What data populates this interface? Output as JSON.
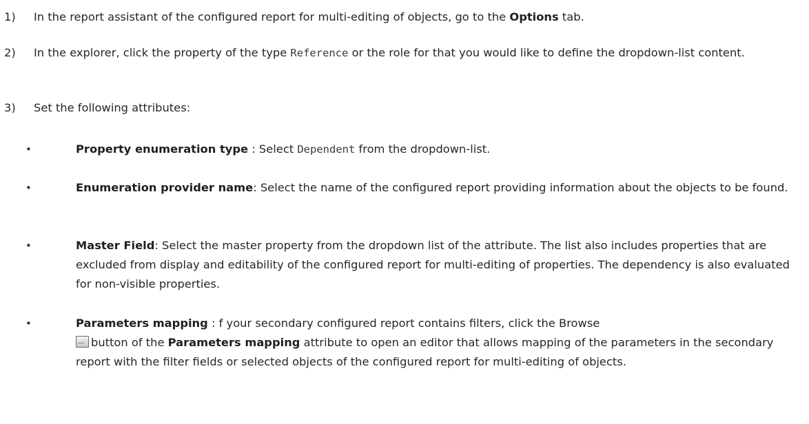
{
  "steps": [
    {
      "number": "1)",
      "text_before": "In the report assistant of the configured report for multi-editing of objects, go to the ",
      "bold": "Options",
      "text_after": " tab."
    },
    {
      "number": "2)",
      "text_before": "In the explorer, click the property of the type ",
      "code": "Reference",
      "text_after": " or the role for that you would like to define the dropdown-list content."
    },
    {
      "number": "3)",
      "text": "Set the following attributes:"
    }
  ],
  "bullets": [
    {
      "symbol": "•",
      "label": "Property enumeration type",
      "text_before": " : Select ",
      "code": "Dependent",
      "text_after": " from the dropdown-list."
    },
    {
      "symbol": "•",
      "label": "Enumeration provider name",
      "text": ": Select the name of the configured report providing information about the objects to be found."
    },
    {
      "symbol": "•",
      "label": "Master Field",
      "text": ": Select the master property from the dropdown list of the attribute. The list also includes properties that are excluded from display and editability of the configured report for multi-editing of properties. The dependency is also evaluated for non-visible properties."
    },
    {
      "symbol": "•",
      "label": "Parameters mapping",
      "text_before": " : f your secondary configured report contains filters, click the Browse",
      "icon": "browse-button-icon",
      "text_middle": "button of the ",
      "label2": "Parameters mapping",
      "text_after": " attribute to open an editor that allows mapping of the parameters in the secondary report with the filter fields or selected objects of the configured report for multi-editing of objects."
    }
  ]
}
